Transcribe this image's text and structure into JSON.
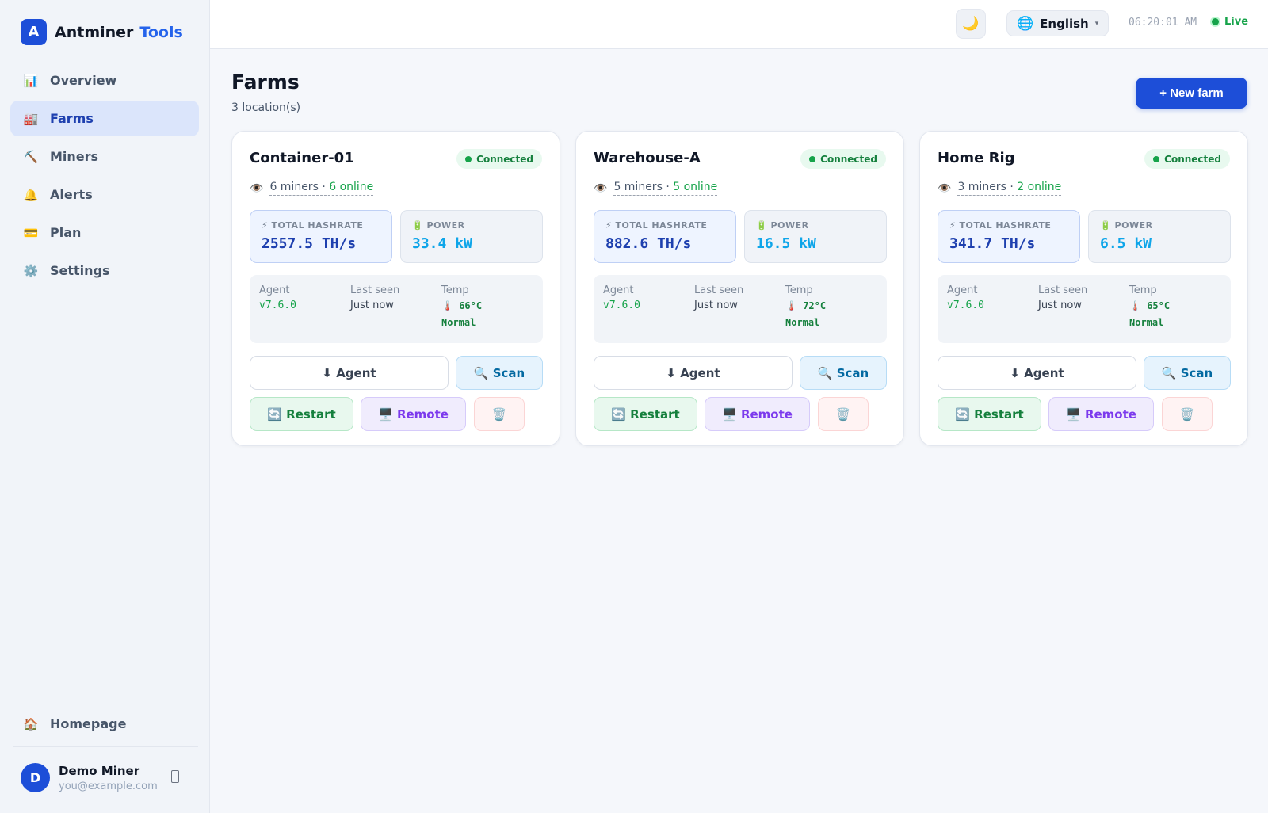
{
  "brand": {
    "logo_letter": "A",
    "name": "Antminer",
    "accent": "Tools"
  },
  "sidebar": {
    "items": [
      {
        "icon": "📊",
        "icon_name": "chart-icon",
        "label": "Overview"
      },
      {
        "icon": "🏭",
        "icon_name": "factory-icon",
        "label": "Farms",
        "active": true
      },
      {
        "icon": "⛏️",
        "icon_name": "pickaxe-icon",
        "label": "Miners"
      },
      {
        "icon": "🔔",
        "icon_name": "bell-icon",
        "label": "Alerts"
      },
      {
        "icon": "💳",
        "icon_name": "credit-card-icon",
        "label": "Plan"
      },
      {
        "icon": "⚙️",
        "icon_name": "gear-icon",
        "label": "Settings"
      }
    ],
    "homepage": {
      "icon": "🏠",
      "label": "Homepage"
    },
    "user": {
      "initial": "D",
      "name": "Demo Miner",
      "email": "you@example.com"
    }
  },
  "header": {
    "theme_icon": "🌙",
    "language": {
      "icon": "🌐",
      "label": "English",
      "caret": "▾"
    },
    "clock": "06:20:01 AM",
    "live_label": "Live"
  },
  "page": {
    "title": "Farms",
    "subtitle": "3 location(s)",
    "new_farm_label": "+ New farm"
  },
  "labels": {
    "eye_icon": "👁️",
    "hashrate_label": "⚡ TOTAL HASHRATE",
    "power_label": "🔋 POWER",
    "agent_label": "Agent",
    "last_seen_label": "Last seen",
    "temp_label": "Temp",
    "thermo_icon": "🌡️",
    "btn_agent": "⬇ Agent",
    "btn_scan": "🔍 Scan",
    "btn_restart": "🔄 Restart",
    "btn_remote": "🖥️ Remote",
    "btn_delete": "🗑️"
  },
  "farms": [
    {
      "name": "Container-01",
      "status": "Connected",
      "miners": "6 miners",
      "sep": "·",
      "online": "6 online",
      "hashrate": "2557.5 TH/s",
      "power": "33.4 kW",
      "agent_version": "v7.6.0",
      "last_seen": "Just now",
      "temp": "66°C",
      "temp_status": "Normal"
    },
    {
      "name": "Warehouse-A",
      "status": "Connected",
      "miners": "5 miners",
      "sep": "·",
      "online": "5 online",
      "hashrate": "882.6 TH/s",
      "power": "16.5 kW",
      "agent_version": "v7.6.0",
      "last_seen": "Just now",
      "temp": "72°C",
      "temp_status": "Normal"
    },
    {
      "name": "Home Rig",
      "status": "Connected",
      "miners": "3 miners",
      "sep": "·",
      "online": "2 online",
      "hashrate": "341.7 TH/s",
      "power": "6.5 kW",
      "agent_version": "v7.6.0",
      "last_seen": "Just now",
      "temp": "65°C",
      "temp_status": "Normal"
    }
  ],
  "colors": {
    "primary": "#1d4ed8",
    "success": "#16a34a",
    "sidebar_bg": "#f1f4f9",
    "page_bg": "#f5f7fb"
  }
}
